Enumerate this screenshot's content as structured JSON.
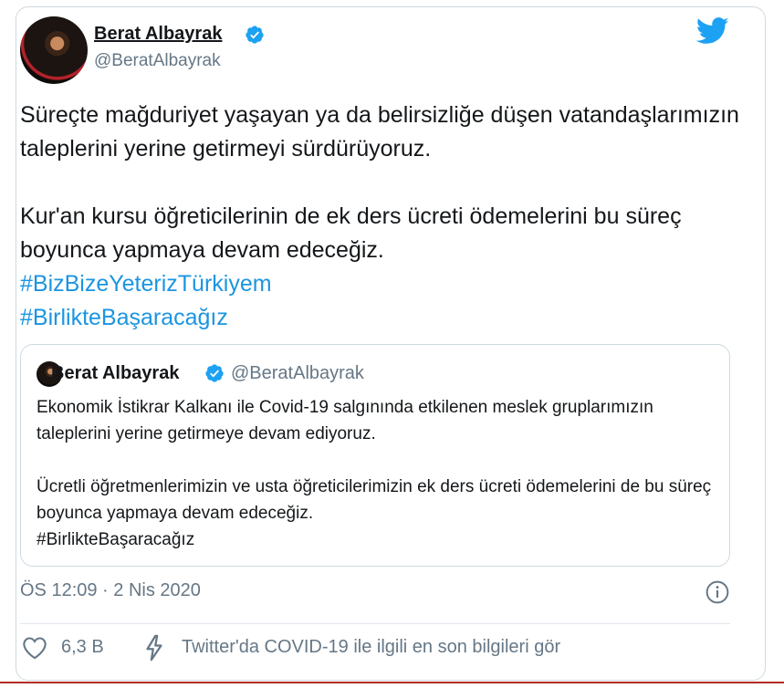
{
  "author": {
    "name": "Berat Albayrak",
    "handle": "@BeratAlbayrak"
  },
  "tweet": {
    "paragraph1": "Süreçte mağduriyet yaşayan ya da belirsizliğe düşen vatandaşlarımızın taleplerini yerine getirmeyi sürdürüyoruz.",
    "paragraph2": "Kur'an kursu öğreticilerinin de ek ders ücreti ödemelerini bu süreç boyunca yapmaya devam edeceğiz.",
    "hashtag1": "#BizBizeYeterizTürkiyem",
    "hashtag2": "#BirlikteBaşaracağız"
  },
  "quoted": {
    "name": "Berat Albayrak",
    "handle": "@BeratAlbayrak",
    "paragraph1": "Ekonomik İstikrar Kalkanı ile Covid-19 salgınında etkilenen meslek gruplarımızın taleplerini yerine getirmeye devam ediyoruz.",
    "paragraph2": "Ücretli öğretmenlerimizin ve usta öğreticilerimizin ek ders ücreti ödemelerini de bu süreç boyunca yapmaya devam edeceğiz.",
    "hashtag": "#BirlikteBaşaracağız"
  },
  "meta": {
    "timestamp": "ÖS 12:09 · 2 Nis 2020"
  },
  "actions": {
    "like_count": "6,3 B",
    "covid_link": "Twitter'da COVID-19 ile ilgili en son bilgileri gör"
  },
  "icons": {
    "verified": "verified-badge-icon",
    "twitter": "twitter-bird-icon",
    "info": "info-icon",
    "like": "heart-icon",
    "covid": "lightning-icon"
  },
  "colors": {
    "accent": "#1da1f2",
    "hashtag": "#1b95e0",
    "muted": "#657786"
  }
}
